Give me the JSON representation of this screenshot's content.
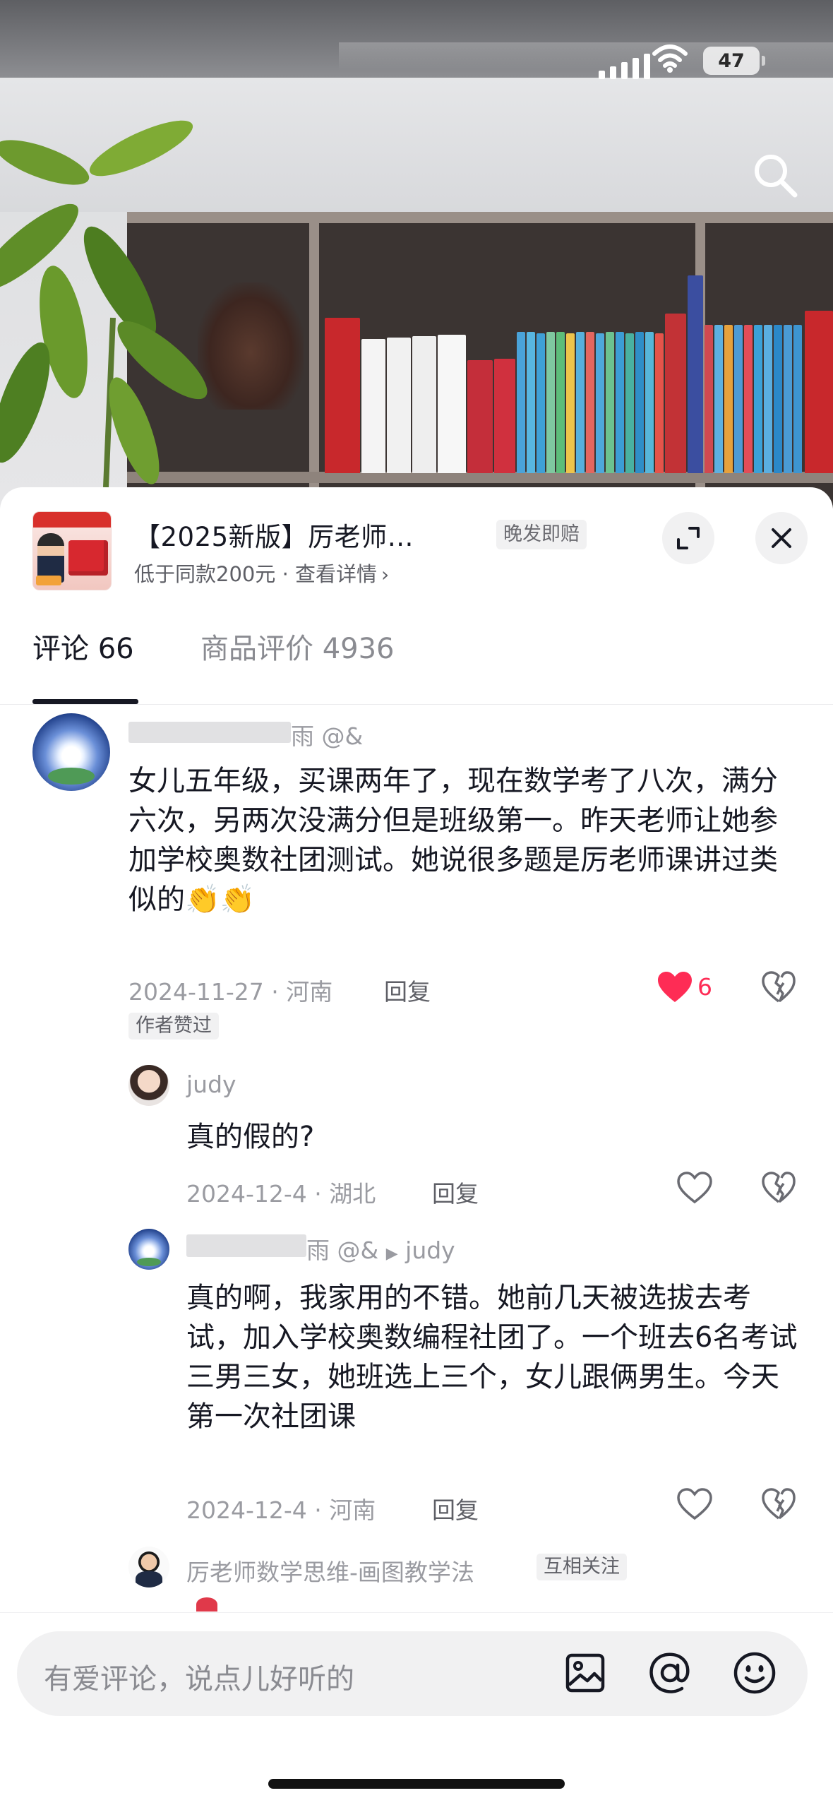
{
  "status_bar": {
    "battery": "47"
  },
  "product": {
    "title": "【2025新版】厉老师…",
    "badge": "晚发即赔",
    "subtitle": "低于同款200元 · 查看详情",
    "subtitle_chevron": "›"
  },
  "tabs": {
    "comments_label": "评论 66",
    "reviews_label": "商品评价 4936"
  },
  "comments": [
    {
      "username": "雨 @&",
      "text": "女儿五年级，买课两年了，现在数学考了八次，满分六次，另两次没满分但是班级第一。昨天老师让她参加学校奥数社团测试。她说很多题是厉老师课讲过类似的👏👏",
      "meta": "2024-11-27 · 河南",
      "reply_label": "回复",
      "likes": "6",
      "liked": true,
      "author_badge": "作者赞过"
    },
    {
      "username": "judy",
      "text": "真的假的?",
      "meta": "2024-12-4 · 湖北",
      "reply_label": "回复"
    },
    {
      "username": "雨 @&",
      "reply_to": "judy",
      "text": "真的啊，我家用的不错。她前几天被选拔去考试，加入学校奥数编程社团了。一个班去6名考试三男三女，她班选上三个，女儿跟俩男生。今天第一次社团课",
      "meta": "2024-12-4 · 河南",
      "reply_label": "回复"
    },
    {
      "username": "厉老师数学思维-画图教学法",
      "badge": "互相关注"
    }
  ],
  "input": {
    "placeholder": "有爱评论，说点儿好听的"
  },
  "colors": {
    "like": "#fe2c55",
    "text": "#161823",
    "muted": "#9a9ba1"
  }
}
